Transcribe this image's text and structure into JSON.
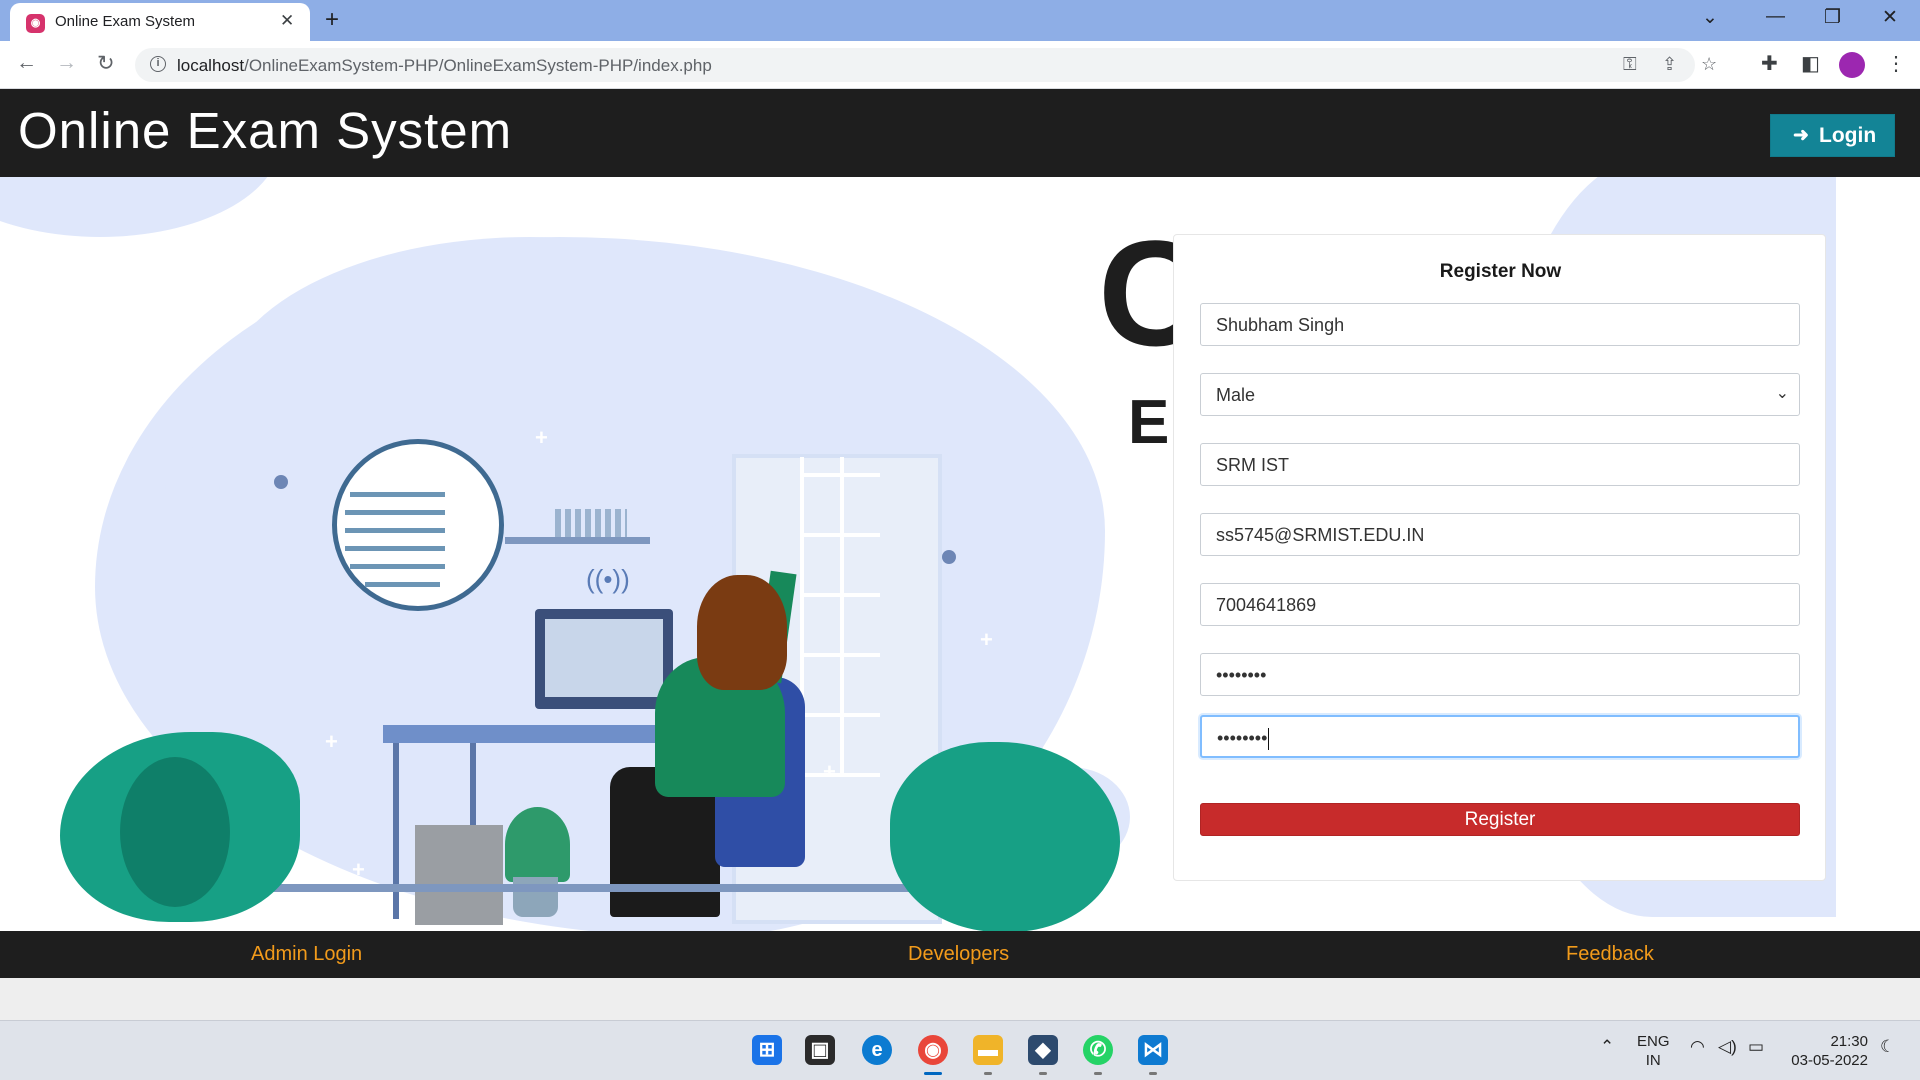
{
  "browser": {
    "tab_title": "Online Exam System",
    "tab_close": "✕",
    "new_tab": "+",
    "url_path": "localhost/OnlineExamSystem-PHP/OnlineExamSystem-PHP/index.php",
    "window_controls": {
      "dropdown": "⌄",
      "minimize": "—",
      "restore": "❐",
      "close": "✕"
    }
  },
  "header": {
    "brand": "Online Exam System",
    "login_label": "Login",
    "login_icon": "sign-in-icon"
  },
  "hero": {
    "headline_partial": "C",
    "subline_partial": "E"
  },
  "register": {
    "title": "Register Now",
    "name_value": "Shubham Singh",
    "gender_value": "Male",
    "college_value": "SRM IST",
    "email_value": "ss5745@SRMIST.EDU.IN",
    "phone_value": "7004641869",
    "password_value": "••••••••",
    "confirm_password_value": "••••••••",
    "submit_label": "Register"
  },
  "footer": {
    "admin_login": "Admin Login",
    "developers": "Developers",
    "feedback": "Feedback"
  },
  "taskbar": {
    "language": "ENG",
    "region": "IN",
    "time": "21:30",
    "date": "03-05-2022"
  },
  "colors": {
    "header_bg": "#1e1e1e",
    "login_btn": "#138496",
    "register_btn": "#c72b2b",
    "footer_link": "#f29b1b",
    "illustration_bg": "#dfe7fb"
  }
}
